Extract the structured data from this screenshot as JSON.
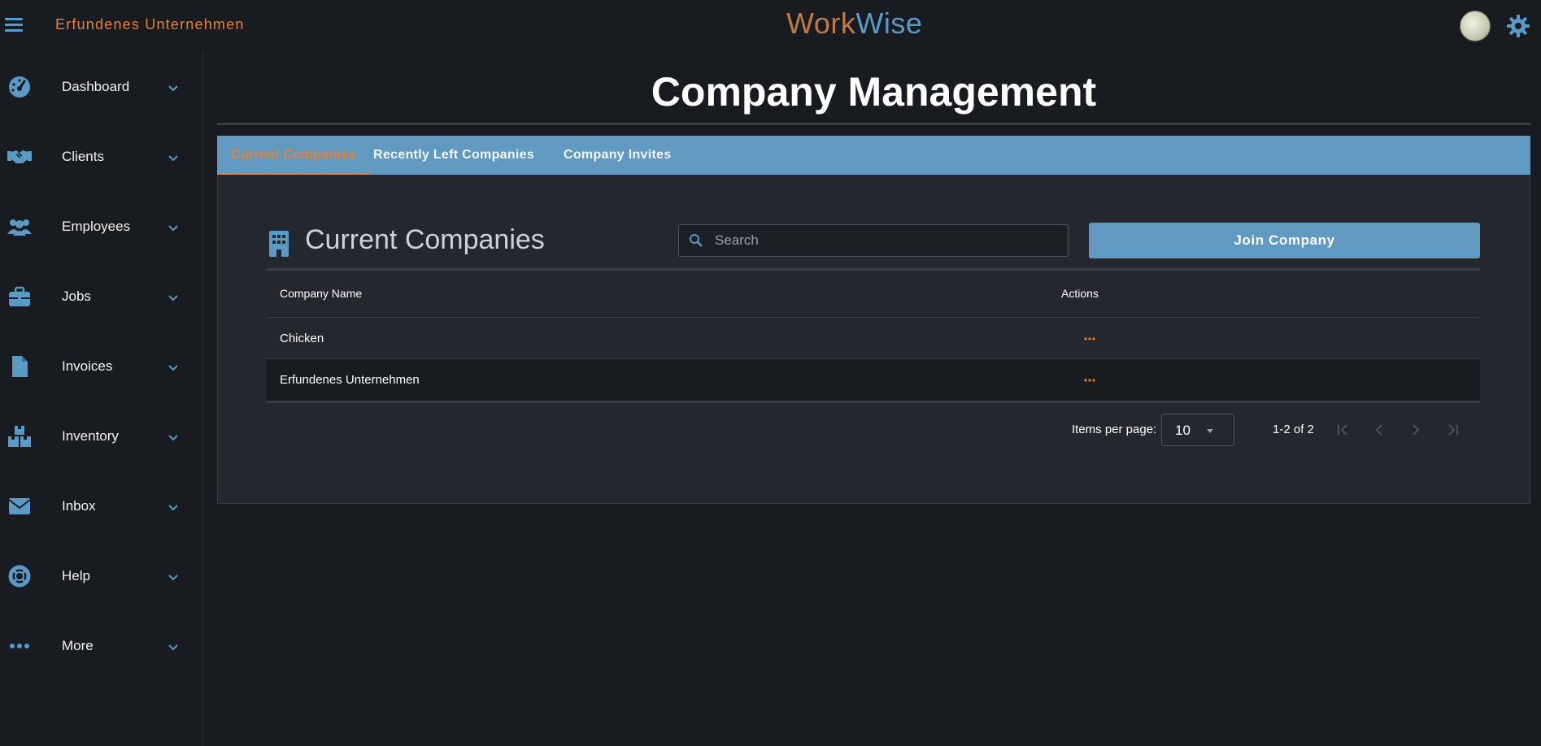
{
  "header": {
    "company_name": "Erfundenes Unternehmen",
    "brand_work": "Work",
    "brand_wise": "Wise",
    "menu_icon": "hamburger-menu-icon",
    "avatar": "user-avatar",
    "settings_icon": "gear-icon"
  },
  "sidebar": {
    "items": [
      {
        "label": "Dashboard",
        "icon": "speedometer-icon"
      },
      {
        "label": "Clients",
        "icon": "handshake-icon"
      },
      {
        "label": "Employees",
        "icon": "users-icon"
      },
      {
        "label": "Jobs",
        "icon": "briefcase-icon"
      },
      {
        "label": "Invoices",
        "icon": "document-icon"
      },
      {
        "label": "Inventory",
        "icon": "boxes-icon"
      },
      {
        "label": "Inbox",
        "icon": "envelope-icon"
      },
      {
        "label": "Help",
        "icon": "lifebuoy-icon"
      },
      {
        "label": "More",
        "icon": "ellipsis-icon"
      }
    ]
  },
  "main": {
    "title": "Company Management",
    "tabs": [
      {
        "label": "Current Companies",
        "active": true
      },
      {
        "label": "Recently Left Companies",
        "active": false
      },
      {
        "label": "Company Invites",
        "active": false
      }
    ],
    "section_title": "Current Companies",
    "section_icon": "building-icon",
    "search": {
      "placeholder": "Search",
      "value": ""
    },
    "join_button": "Join Company",
    "table": {
      "columns": [
        "Company Name",
        "Actions"
      ],
      "rows": [
        {
          "name": "Chicken",
          "action": "more-options-icon"
        },
        {
          "name": "Erfundenes Unternehmen",
          "action": "more-options-icon"
        }
      ]
    },
    "pagination": {
      "items_per_page_label": "Items per page:",
      "items_per_page": "10",
      "range": "1-2 of 2"
    }
  },
  "colors": {
    "accent_orange": "#e0823f",
    "accent_blue": "#6199c0",
    "background": "#181b1f",
    "panel": "#24272d"
  }
}
